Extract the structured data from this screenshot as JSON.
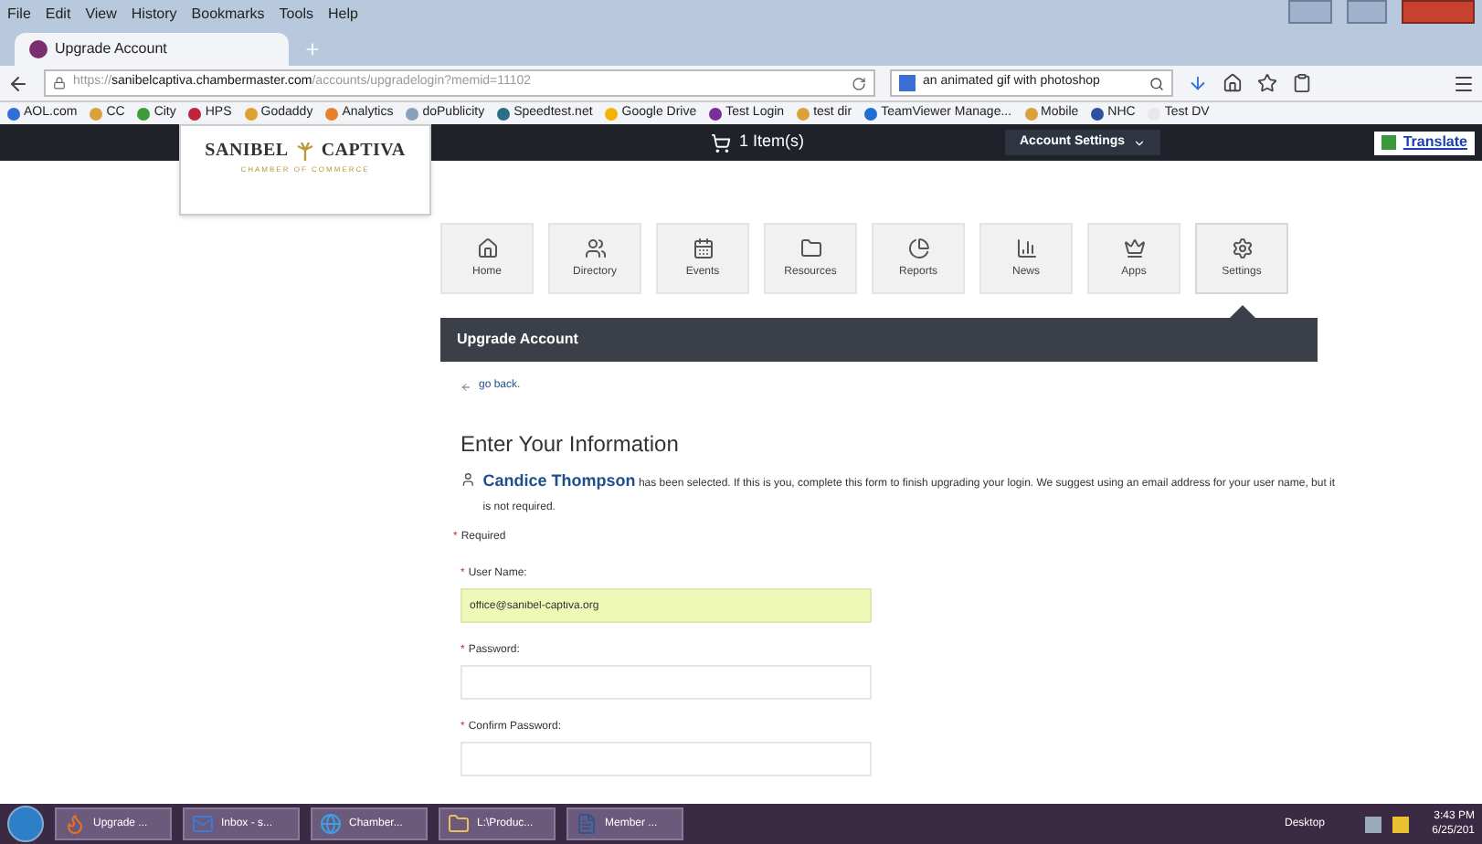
{
  "browser": {
    "menu": [
      "File",
      "Edit",
      "View",
      "History",
      "Bookmarks",
      "Tools",
      "Help"
    ],
    "tab": {
      "title": "Upgrade Account"
    },
    "url": {
      "prefix": "https://",
      "host": "sanibelcaptiva.chambermaster.com",
      "path": "/accounts/upgradelogin?memid=11102"
    },
    "search": {
      "value": "an animated gif with photoshop"
    },
    "bookmarks": [
      {
        "label": "AOL.com",
        "color": "#2f6fd6"
      },
      {
        "label": "CC",
        "color": "#d9a23a"
      },
      {
        "label": "City",
        "color": "#3f9a3a"
      },
      {
        "label": "HPS",
        "color": "#c0233b"
      },
      {
        "label": "Godaddy",
        "color": "#e0a030"
      },
      {
        "label": "Analytics",
        "color": "#e87f2d"
      },
      {
        "label": "doPublicity",
        "color": "#8aa0b8"
      },
      {
        "label": "Speedtest.net",
        "color": "#2a6e88"
      },
      {
        "label": "Google Drive",
        "color": "#f2b400"
      },
      {
        "label": "Test Login",
        "color": "#7b2e9a"
      },
      {
        "label": "test dir",
        "color": "#d9a23a"
      },
      {
        "label": "TeamViewer Manage...",
        "color": "#1e6fd0"
      },
      {
        "label": "Mobile",
        "color": "#d9a23a"
      },
      {
        "label": "NHC",
        "color": "#2f4fa0"
      },
      {
        "label": "Test DV",
        "color": "#e8e8e8"
      }
    ]
  },
  "site": {
    "cart": "1 Item(s)",
    "account_settings": "Account Settings",
    "translate": "Translate",
    "logo": {
      "name_left": "SANIBEL",
      "name_right": "CAPTIVA",
      "tagline": "CHAMBER OF COMMERCE"
    },
    "nav": [
      {
        "label": "Home",
        "kind": "home",
        "selected": false
      },
      {
        "label": "Directory",
        "kind": "users",
        "selected": false
      },
      {
        "label": "Events",
        "kind": "calendar",
        "selected": false
      },
      {
        "label": "Resources",
        "kind": "folder",
        "selected": false
      },
      {
        "label": "Reports",
        "kind": "chart",
        "selected": false
      },
      {
        "label": "News",
        "kind": "bars",
        "selected": false
      },
      {
        "label": "Apps",
        "kind": "chess",
        "selected": false
      },
      {
        "label": "Settings",
        "kind": "gear",
        "selected": true
      }
    ],
    "panel_title": "Upgrade Account",
    "go_back": "go back.",
    "heading": "Enter Your Information",
    "person": "Candice Thompson",
    "message": "has been selected. If this is you, complete this form to finish upgrading your login. We suggest using an email address for your user name, but it is not required.",
    "required_mark": "*",
    "required": "Required",
    "fields": [
      {
        "mark": "*",
        "label": "User Name:",
        "value": "office@sanibel-captiva.org",
        "highlighted": true
      },
      {
        "mark": "*",
        "label": "Password:",
        "highlighted": false
      },
      {
        "mark": "*",
        "label": "Confirm Password:",
        "highlighted": false
      }
    ]
  },
  "taskbar": {
    "items": [
      {
        "label": "Upgrade ...",
        "kind": "firefox"
      },
      {
        "label": "Inbox - s...",
        "kind": "mail"
      },
      {
        "label": "Chamber...",
        "kind": "ie"
      },
      {
        "label": "L:\\Produc...",
        "kind": "folder"
      },
      {
        "label": "Member ...",
        "kind": "word"
      }
    ],
    "desktop": "Desktop",
    "time": "3:43 PM",
    "date": "6/25/201"
  }
}
